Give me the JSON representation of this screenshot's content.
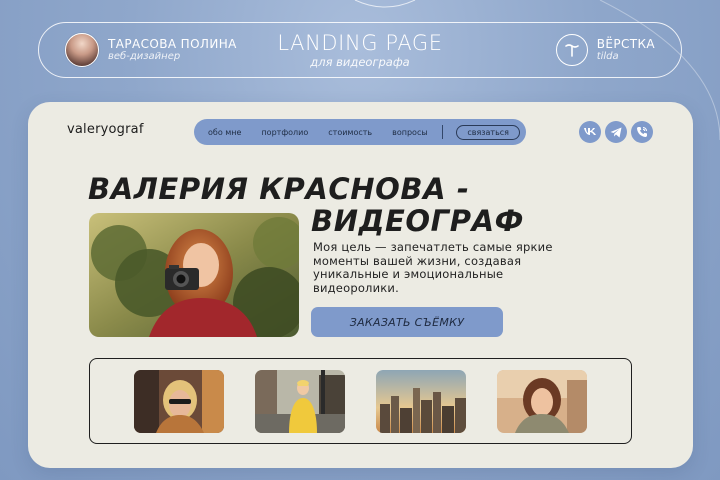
{
  "presentation": {
    "author_name": "ТАРАСОВА ПОЛИНА",
    "author_role": "веб-дизайнер",
    "title": "LANDING PAGE",
    "subtitle": "для видеографа",
    "tool_name": "ВЁРСТКА",
    "tool_sub": "tilda"
  },
  "site": {
    "logo": "valeryograf",
    "nav": {
      "items": [
        {
          "label": "обо мне"
        },
        {
          "label": "портфолио"
        },
        {
          "label": "стоимость"
        },
        {
          "label": "вопросы"
        }
      ],
      "cta_label": "связаться"
    },
    "socials": [
      {
        "icon": "vk-icon"
      },
      {
        "icon": "telegram-icon"
      },
      {
        "icon": "phone-icon"
      }
    ],
    "hero": {
      "headline_line1": "ВАЛЕРИЯ КРАСНОВА -",
      "headline_line2": "ВИДЕОГРАФ",
      "description": "Моя цель — запечатлеть самые яркие моменты вашей жизни, создавая уникальные и эмоциональные видеоролики.",
      "cta_label": "ЗАКАЗАТЬ СЪЁМКУ"
    },
    "gallery_count": 4
  },
  "colors": {
    "accent": "#7f9acb",
    "card": "#ecebe3",
    "background": "#8fa7cb"
  }
}
